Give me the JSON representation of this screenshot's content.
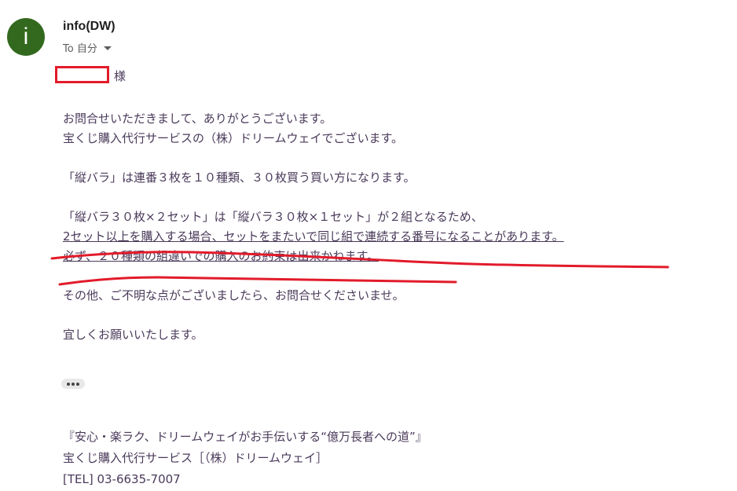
{
  "header": {
    "avatar_letter": "i",
    "avatar_color": "#33691e",
    "sender": "info(DW)",
    "recipient_label": "To 自分"
  },
  "salutation": "様",
  "body": {
    "lines": [
      "お問合せいただきまして、ありがとうございます。",
      "宝くじ購入代行サービスの（株）ドリームウェイでございます。",
      "「縦バラ」は連番３枚を１０種類、３０枚買う買い方になります。",
      "「縦バラ３０枚×２セット」は「縦バラ３０枚×１セット」が２組となるため、",
      "2セット以上を購入する場合、セットをまたいで同じ組で連続する番号になることがあります。",
      "必ず、２０種類の組違いでの購入のお約束は出来かねます。",
      "その他、ご不明な点がございましたら、お問合せくださいませ。",
      "宜しくお願いいたします。"
    ]
  },
  "trimmed_content_button": "show-trimmed-content",
  "signature": {
    "lines": [
      "『安心・楽ラク、ドリームウェイがお手伝いする“億万長者への道”』",
      "宝くじ購入代行サービス［（株）ドリームウェイ］",
      "[TEL] 03-6635-7007"
    ]
  },
  "annotation_color": "#e21b2a"
}
